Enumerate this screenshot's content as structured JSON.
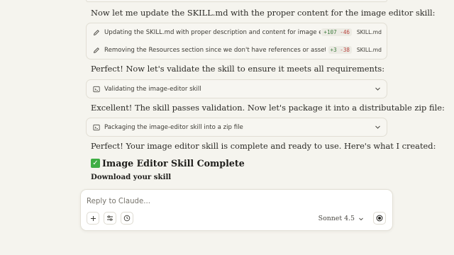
{
  "messages": {
    "p1": "Now let me update the SKILL.md with the proper content for the image editor skill:",
    "p2": "Perfect! Now let's validate the skill to ensure it meets all requirements:",
    "p3": "Excellent! The skill passes validation. Now let's package it into a distributable zip file:",
    "p4": "Perfect! Your image editor skill is complete and ready to use. Here's what I created:",
    "heading": "Image Editor Skill Complete",
    "heading_emoji": "✓",
    "subheading": "Download your skill"
  },
  "edits": [
    {
      "text": "Updating the SKILL.md with proper description and content for image editor …",
      "added": "+107",
      "removed": "-46",
      "file": "SKILL.md",
      "icon": "pencil-icon"
    },
    {
      "text": "Removing the Resources section since we don't have references or assets dire…",
      "added": "+3",
      "removed": "-38",
      "file": "SKILL.md",
      "icon": "pencil-icon"
    }
  ],
  "tasks": [
    {
      "label": "Validating the image-editor skill",
      "icon": "terminal-icon"
    },
    {
      "label": "Packaging the image-editor skill into a zip file",
      "icon": "terminal-icon"
    }
  ],
  "composer": {
    "placeholder": "Reply to Claude...",
    "model": "Sonnet 4.5",
    "buttons": [
      "plus-icon",
      "sliders-icon",
      "clock-icon"
    ],
    "send_icon": "record-icon"
  },
  "colors": {
    "background": "#f5f4ee",
    "card": "#f7f6f1",
    "added": "#3d7b3c",
    "removed": "#b8413b",
    "check": "#3fae45"
  }
}
